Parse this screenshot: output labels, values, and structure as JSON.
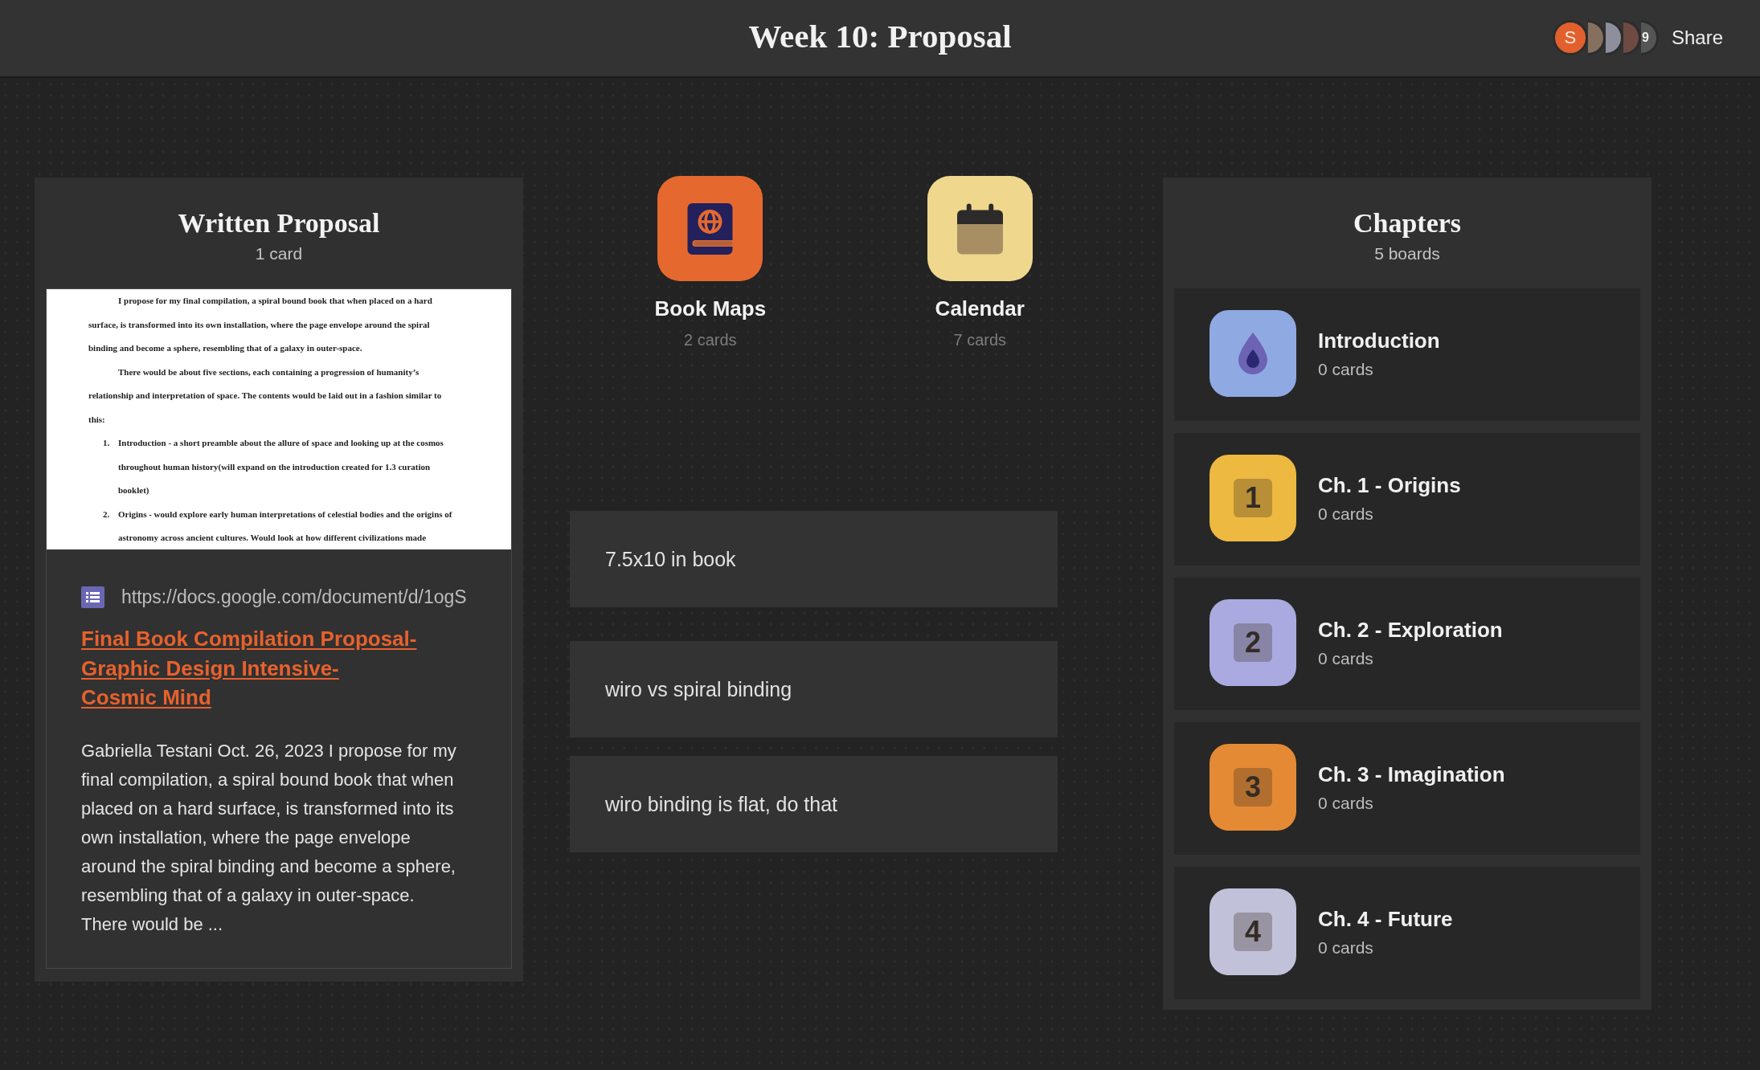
{
  "header": {
    "title": "Week 10: Proposal",
    "avatars": [
      {
        "kind": "initial",
        "initial": "S",
        "color": "#e2602d"
      },
      {
        "kind": "photo"
      },
      {
        "kind": "photo"
      },
      {
        "kind": "photo"
      },
      {
        "kind": "count",
        "count": "9"
      }
    ],
    "share": "Share"
  },
  "written_proposal": {
    "title": "Written Proposal",
    "count": "1 card",
    "doc_preview": {
      "paragraphs": [
        {
          "kind": "para",
          "lines": [
            "I propose for my final compilation, a spiral bound book that when placed on a hard",
            "surface, is transformed into its own installation, where the page envelope around the spiral",
            "binding and become a sphere, resembling that of a galaxy in outer-space."
          ]
        },
        {
          "kind": "para",
          "lines": [
            "There would be about five sections, each containing a progression of humanity’s",
            "relationship and interpretation of space. The contents would be laid out in a fashion similar to",
            "this:"
          ]
        },
        {
          "kind": "item",
          "number": "1.",
          "lines": [
            "Introduction - a short preamble about the allure of space and looking up at the cosmos",
            "throughout human history(will expand on the introduction created for 1.3 curation",
            "booklet)"
          ]
        },
        {
          "kind": "item",
          "number": "2.",
          "lines": [
            "Origins - would explore early human interpretations of celestial bodies and the origins of",
            "astronomy across ancient cultures. Would look at how different civilizations made"
          ]
        }
      ]
    },
    "link": {
      "url": "https://docs.google.com/document/d/1ogS",
      "title_lines": [
        "Final Book Compilation Proposal-",
        "Graphic Design Intensive-",
        "Cosmic Mind"
      ]
    },
    "description": "Gabriella Testani Oct. 26, 2023 I propose for my final compilation, a spiral bound book that when placed on a hard surface, is transformed into its own installation, where the page envelope around the spiral binding and become a sphere, resembling that of a galaxy in outer-space. There would be ..."
  },
  "boards": [
    {
      "title": "Book Maps",
      "count": "2 cards",
      "kind": "book-globe",
      "color": "#e5692f"
    },
    {
      "title": "Calendar",
      "count": "7 cards",
      "kind": "calendar",
      "color": "#efd78e"
    }
  ],
  "notes": [
    "7.5x10 in book",
    "wiro vs spiral binding",
    "wiro binding is flat, do that"
  ],
  "chapters": {
    "title": "Chapters",
    "count": "5 boards",
    "items": [
      {
        "title": "Introduction",
        "count": "0 cards",
        "kind": "droplet",
        "color": "#8fa9e2"
      },
      {
        "title": "Ch. 1 - Origins",
        "count": "0 cards",
        "kind": "keycap",
        "digit": "1",
        "color": "#eeb941"
      },
      {
        "title": "Ch. 2 - Exploration",
        "count": "0 cards",
        "kind": "keycap",
        "digit": "2",
        "color": "#aaaae0"
      },
      {
        "title": "Ch. 3 - Imagination",
        "count": "0 cards",
        "kind": "keycap",
        "digit": "3",
        "color": "#e48a35"
      },
      {
        "title": "Ch. 4 - Future",
        "count": "0 cards",
        "kind": "keycap",
        "digit": "4",
        "color": "#c1c1da"
      }
    ]
  }
}
